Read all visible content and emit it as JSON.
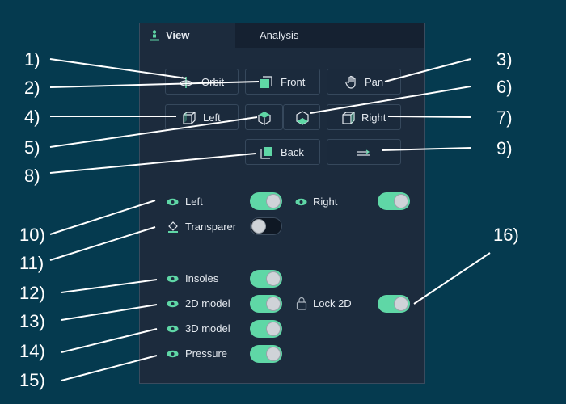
{
  "tabs": {
    "view": "View",
    "analysis": "Analysis"
  },
  "buttons": {
    "orbit": "Orbit",
    "front": "Front",
    "pan": "Pan",
    "left": "Left",
    "right": "Right",
    "back": "Back"
  },
  "toggles": {
    "left": "Left",
    "right": "Right",
    "transparent": "Transparer",
    "insoles": "Insoles",
    "model2d": "2D model",
    "lock2d": "Lock 2D",
    "model3d": "3D model",
    "pressure": "Pressure"
  },
  "toggle_states": {
    "left": true,
    "right": true,
    "transparent": false,
    "insoles": true,
    "model2d": true,
    "lock2d": true,
    "model3d": true,
    "pressure": true
  },
  "callouts": [
    "1)",
    "2)",
    "3)",
    "4)",
    "5)",
    "6)",
    "7)",
    "8)",
    "9)",
    "10)",
    "11)",
    "12)",
    "13)",
    "14)",
    "15)",
    "16)"
  ],
  "colors": {
    "accent": "#5fd7a6",
    "background": "#053a4f",
    "panel": "#1c2b3d"
  }
}
